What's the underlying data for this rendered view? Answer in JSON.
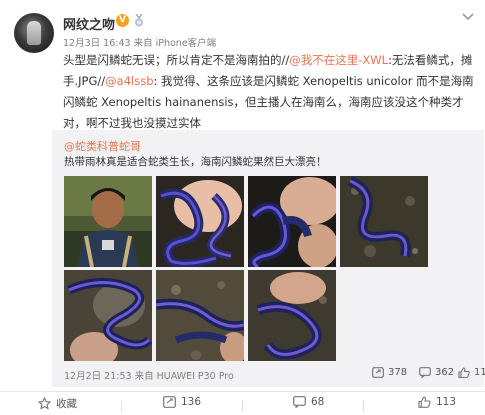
{
  "post": {
    "username": "网纹之吻",
    "verified_badge": "V",
    "verified_color": "#f7a21b",
    "time": "12月3日 16:43",
    "source_prefix": "来自",
    "source": "iPhone客户端",
    "text": {
      "seg1": "头型是闪鳞蛇无误；所以肯定不是海南拍的//",
      "mention1": "@我不在这里-XWL",
      "seg2": ":无法看鳞式，摊手.JPG//",
      "mention2": "@a4lssb",
      "seg3": ": 我觉得、这条应该是闪鳞蛇 Xenopeltis unicolor 而不是海南闪鳞蛇 Xenopeltis hainanensis，但主播人在海南么，海南应该没这个种类才对，啊不过我也没摸过实体"
    },
    "accent": "#eb7350",
    "more_icon": "chevron-down-icon"
  },
  "repost": {
    "author": "@蛇类科普蛇哥",
    "text": "热带雨林真是适合蛇类生长，海南闪鳞蛇果然巨大漂亮！",
    "time": "12月2日 21:53",
    "source_prefix": "来自",
    "source": "HUAWEI P30 Pro",
    "shares": "378",
    "comments": "362",
    "likes": "1122",
    "images": [
      {
        "name": "photo-boy"
      },
      {
        "name": "photo-snake-hand-1"
      },
      {
        "name": "photo-snake-hand-2"
      },
      {
        "name": "photo-snake-ground-1"
      },
      {
        "name": "photo-snake-rock"
      },
      {
        "name": "photo-snake-ground-2"
      },
      {
        "name": "photo-snake-hand-3"
      }
    ]
  },
  "actions": {
    "favorite_label": "收藏",
    "share_count": "136",
    "comment_count": "68",
    "like_count": "113"
  }
}
